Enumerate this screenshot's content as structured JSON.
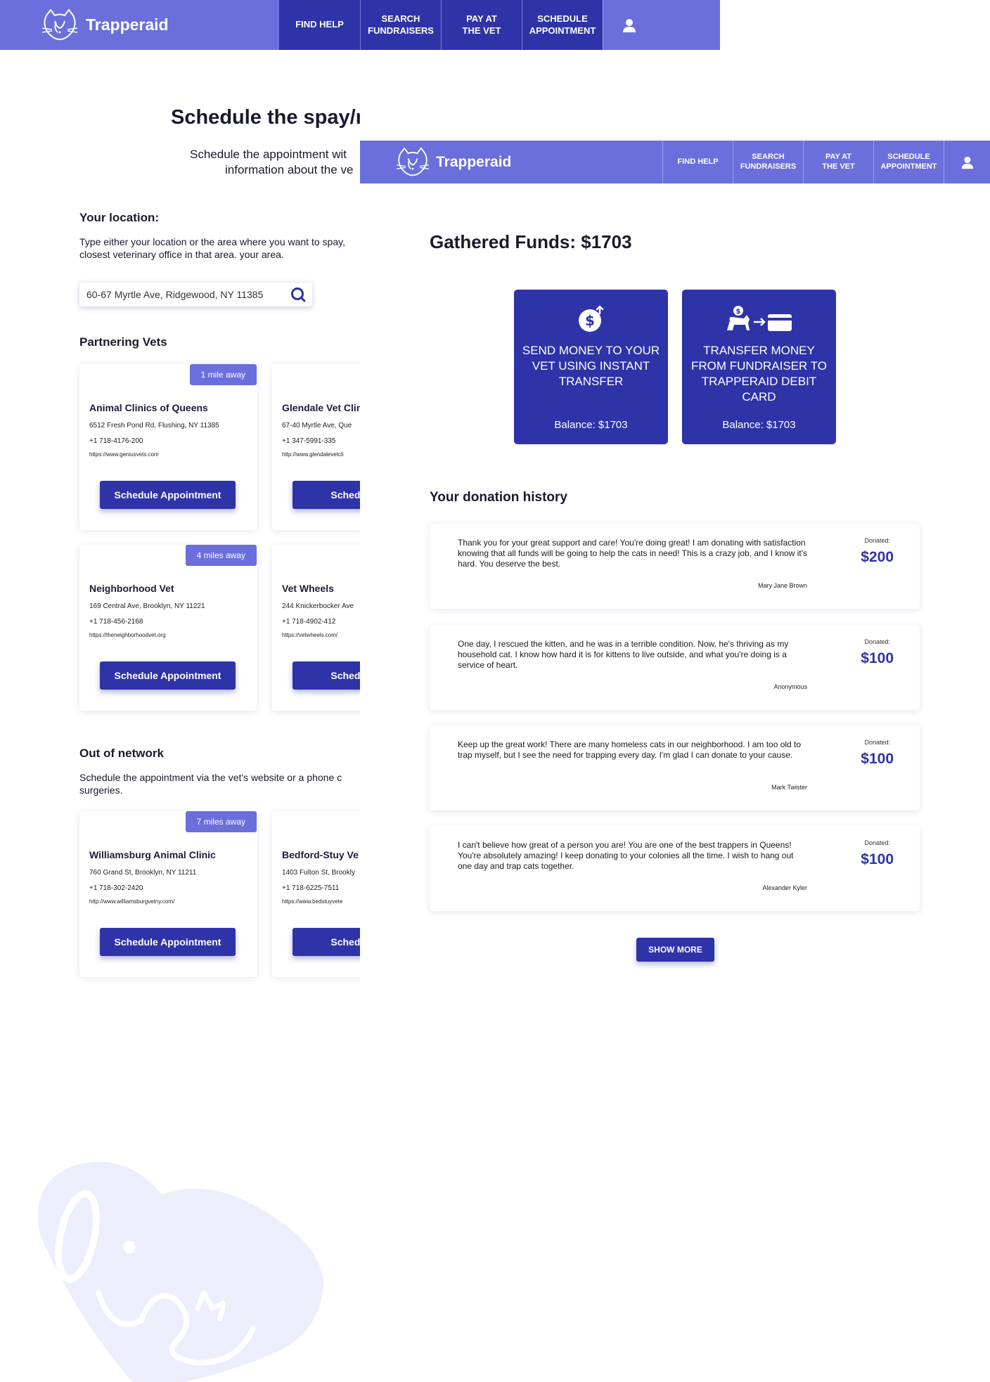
{
  "brand": {
    "name": "Trapperaid"
  },
  "nav": {
    "find_help": "FIND HELP",
    "search_fundraisers_1": "SEARCH",
    "search_fundraisers_2": "FUNDRAISERS",
    "pay_vet_1": "PAY AT",
    "pay_vet_2": "THE VET",
    "schedule_1": "SCHEDULE",
    "schedule_2": "APPOINTMENT"
  },
  "schedule_page": {
    "title": "Schedule the spay/neuter appointment",
    "subtitle_1": "Schedule the appointment wit",
    "subtitle_2": "information about the ve",
    "location_heading": "Your location:",
    "location_text_1": "Type either your location or the area where you want to spay,",
    "location_text_2": "closest veterinary office in that area. your area.",
    "search_value": "60-67 Myrtle Ave, Ridgewood, NY 11385",
    "partnering_heading": "Partnering Vets",
    "out_network_heading": "Out of network",
    "out_network_text_1": "Schedule the appointment via the vet's website or a phone c",
    "out_network_text_2": "surgeries.",
    "schedule_btn": "Schedule Appointment",
    "schedule_btn_clipped": "Schedule Ap",
    "vets": [
      {
        "distance": "1 mile away",
        "name": "Animal Clinics of Queens",
        "address": "6512 Fresh Pond Rd, Flushing, NY 11385",
        "phone": "+1 718-4176-200",
        "url": "https://www.geniusvets.com"
      },
      {
        "name": "Glendale Vet Clin",
        "address": "67-40 Myrtle Ave, Que",
        "phone": "+1 347-5991-335",
        "url": "http://www.glendalevetcli"
      },
      {
        "distance": "4 miles away",
        "name": "Neighborhood Vet",
        "address": "169 Central Ave, Brooklyn, NY 11221",
        "phone": "+1 718-456-2168",
        "url": "https://theneighborhoodvet.org"
      },
      {
        "name": "Vet Wheels",
        "address": "244 Knickerbocker Ave",
        "phone": "+1 718-4902-412",
        "url": "https://vetwheels.com/"
      },
      {
        "distance": "7 miles away",
        "name": "Williamsburg Animal Clinic",
        "address": "760 Grand St, Brooklyn, NY 11211",
        "phone": "+1 718-302-2420",
        "url": "http://www.williamsburgvetny.com/"
      },
      {
        "name": "Bedford-Stuy Ve",
        "address": "1403 Fulton St, Brookly",
        "phone": "+1 718-6225-7511",
        "url": "https://www.bedstuyvete"
      }
    ]
  },
  "funds_page": {
    "gathered": "Gathered Funds: $1703",
    "actions": [
      {
        "title": "SEND MONEY TO YOUR VET USING INSTANT TRANSFER",
        "balance": "Balance: $1703",
        "icon": "dollar-coin-icon"
      },
      {
        "title": "TRANSFER MONEY FROM FUNDRAISER TO TRAPPERAID DEBIT CARD",
        "balance": "Balance: $1703",
        "icon": "cat-to-card-icon"
      }
    ],
    "history_heading": "Your donation history",
    "donated_label": "Donated:",
    "donations": [
      {
        "message": "Thank you for your great support and care! You're doing great! I am donating with satisfaction knowing that all funds will be going to help the cats in need! This is a crazy job, and I know it's hard. You deserve the best.",
        "name": "Mary Jane Brown",
        "amount": "$200"
      },
      {
        "message": "One day, I rescued the kitten, and he was in a terrible condition. Now, he's thriving as my household cat. I know how hard it is for kittens to live outside, and what you're doing is a service of heart.",
        "name": "Anonymous",
        "amount": "$100"
      },
      {
        "message": "Keep up the great work! There are many homeless cats in our neighborhood. I am too old to trap myself, but I see the need for trapping every day. I'm glad I can donate to your cause.",
        "name": "Mark Twister",
        "amount": "$100"
      },
      {
        "message": "I can't believe how great of a person you are! You are one of the best trappers in Queens! You're absolutely amazing! I keep donating to your colonies all the time. I wish to hang out one day and trap cats together.",
        "name": "Alexander Kyler",
        "amount": "$100"
      }
    ],
    "show_more": "SHOW MORE"
  },
  "colors": {
    "nav": "#6a6fdc",
    "accent": "#2e33a8",
    "watermark": "#eef0fb"
  }
}
